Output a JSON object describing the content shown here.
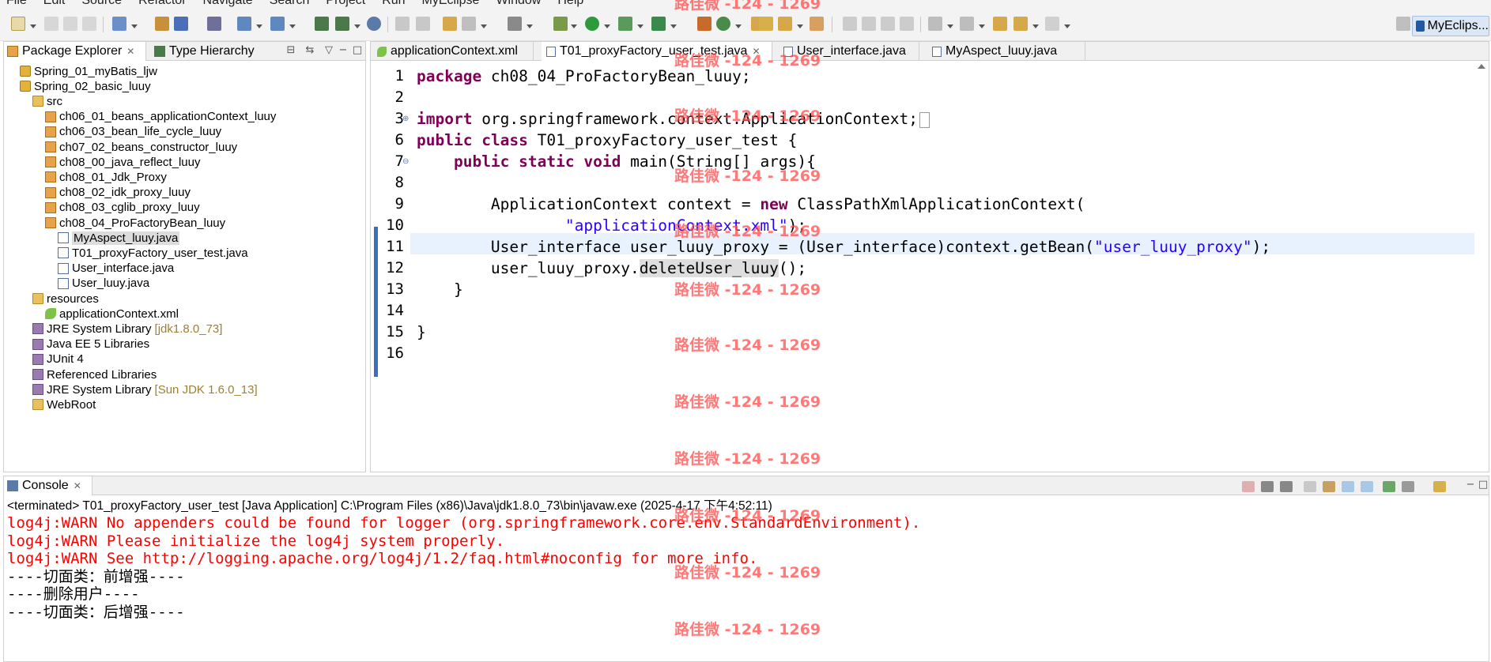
{
  "menubar": [
    "File",
    "Edit",
    "Source",
    "Refactor",
    "Navigate",
    "Search",
    "Project",
    "Run",
    "MyEclipse",
    "Window",
    "Help"
  ],
  "perspective": {
    "label": "MyEclips..."
  },
  "left_view": {
    "tabs": [
      {
        "label": "Package Explorer",
        "active": true
      },
      {
        "label": "Type Hierarchy",
        "active": false
      }
    ],
    "tree": [
      {
        "label": "Spring_01_myBatis_ljw",
        "icon": "project-icon",
        "depth": 0
      },
      {
        "label": "Spring_02_basic_luuy",
        "icon": "project-icon",
        "depth": 0
      },
      {
        "label": "src",
        "icon": "source-folder-icon",
        "depth": 1
      },
      {
        "label": "ch06_01_beans_applicationContext_luuy",
        "icon": "package-icon",
        "depth": 2
      },
      {
        "label": "ch06_03_bean_life_cycle_luuy",
        "icon": "package-icon",
        "depth": 2
      },
      {
        "label": "ch07_02_beans_constructor_luuy",
        "icon": "package-icon",
        "depth": 2
      },
      {
        "label": "ch08_00_java_reflect_luuy",
        "icon": "package-icon",
        "depth": 2
      },
      {
        "label": "ch08_01_Jdk_Proxy",
        "icon": "package-icon",
        "depth": 2
      },
      {
        "label": "ch08_02_idk_proxy_luuy",
        "icon": "package-icon",
        "depth": 2
      },
      {
        "label": "ch08_03_cglib_proxy_luuy",
        "icon": "package-icon",
        "depth": 2
      },
      {
        "label": "ch08_04_ProFactoryBean_luuy",
        "icon": "package-icon",
        "depth": 2
      },
      {
        "label": "MyAspect_luuy.java",
        "icon": "java-file-icon",
        "depth": 3,
        "selected": true
      },
      {
        "label": "T01_proxyFactory_user_test.java",
        "icon": "java-file-icon",
        "depth": 3
      },
      {
        "label": "User_interface.java",
        "icon": "java-file-icon",
        "depth": 3
      },
      {
        "label": "User_luuy.java",
        "icon": "java-file-icon",
        "depth": 3
      },
      {
        "label": "resources",
        "icon": "source-folder-icon",
        "depth": 1
      },
      {
        "label": "applicationContext.xml",
        "icon": "xml-file-icon",
        "depth": 2
      },
      {
        "label": "JRE System Library",
        "decoration": "[jdk1.8.0_73]",
        "icon": "library-icon",
        "depth": 1
      },
      {
        "label": "Java EE 5 Libraries",
        "icon": "library-icon",
        "depth": 1
      },
      {
        "label": "JUnit 4",
        "icon": "library-icon",
        "depth": 1
      },
      {
        "label": "Referenced Libraries",
        "icon": "library-icon",
        "depth": 1
      },
      {
        "label": "JRE System Library",
        "decoration": "[Sun JDK 1.6.0_13]",
        "icon": "library-icon",
        "depth": 1
      },
      {
        "label": "WebRoot",
        "icon": "folder-icon",
        "depth": 1
      }
    ]
  },
  "editor": {
    "tabs": [
      {
        "label": "applicationContext.xml",
        "icon": "xml-file-icon",
        "active": false
      },
      {
        "label": "T01_proxyFactory_user_test.java",
        "icon": "java-file-icon",
        "active": true,
        "closable": true
      },
      {
        "label": "User_interface.java",
        "icon": "java-file-icon",
        "active": false
      },
      {
        "label": "MyAspect_luuy.java",
        "icon": "java-file-icon",
        "active": false
      }
    ],
    "line_numbers": [
      "1",
      "2",
      "3",
      "6",
      "7",
      "8",
      "9",
      "10",
      "11",
      "12",
      "13",
      "14",
      "15",
      "16"
    ],
    "current_line": "8",
    "code": [
      [
        {
          "t": "package",
          "c": "kw"
        },
        {
          "t": " ch08_04_ProFactoryBean_luuy;"
        }
      ],
      [],
      [
        {
          "t": "import",
          "c": "kw"
        },
        {
          "t": " org.springframework.context.ApplicationContext;"
        }
      ],
      [
        {
          "t": "public",
          "c": "kw"
        },
        {
          "t": " "
        },
        {
          "t": "class",
          "c": "kw"
        },
        {
          "t": " T01_proxyFactory_user_test {"
        }
      ],
      [
        {
          "t": "    "
        },
        {
          "t": "public",
          "c": "kw"
        },
        {
          "t": " "
        },
        {
          "t": "static",
          "c": "kw"
        },
        {
          "t": " "
        },
        {
          "t": "void",
          "c": "kw"
        },
        {
          "t": " main(String[] args){"
        }
      ],
      [],
      [
        {
          "t": "        ApplicationContext context = "
        },
        {
          "t": "new",
          "c": "kw"
        },
        {
          "t": " ClassPathXmlApplicationContext("
        }
      ],
      [
        {
          "t": "                "
        },
        {
          "t": "\"applicationContext.xml\"",
          "c": "str"
        },
        {
          "t": ");"
        }
      ],
      [
        {
          "t": "        User_interface user_luuy_proxy = (User_interface)context.getBean("
        },
        {
          "t": "\"user_luuy_proxy\"",
          "c": "str"
        },
        {
          "t": ");"
        }
      ],
      [
        {
          "t": "        user_luuy_proxy."
        },
        {
          "t": "deleteUser_luuy",
          "c": "hl"
        },
        {
          "t": "();"
        }
      ],
      [
        {
          "t": "    }"
        }
      ],
      [],
      [
        {
          "t": "}"
        }
      ],
      []
    ]
  },
  "console": {
    "tab_label": "Console",
    "header": "<terminated> T01_proxyFactory_user_test [Java Application] C:\\Program Files (x86)\\Java\\jdk1.8.0_73\\bin\\javaw.exe (2025-4-17 下午4:52:11)",
    "lines": [
      {
        "text": "log4j:WARN No appenders could be found for logger (org.springframework.core.env.StandardEnvironment).",
        "type": "warn"
      },
      {
        "text": "log4j:WARN Please initialize the log4j system properly.",
        "type": "warn"
      },
      {
        "text": "log4j:WARN See http://logging.apache.org/log4j/1.2/faq.html#noconfig for more info.",
        "type": "warn"
      },
      {
        "text": "----切面类：前增强----",
        "type": "out"
      },
      {
        "text": "----删除用户----",
        "type": "out"
      },
      {
        "text": "----切面类：后增强----",
        "type": "out"
      }
    ]
  },
  "watermark": "路佳微 -124 - 1269",
  "colors": {
    "keyword": "#7f0055",
    "string": "#2a00ff",
    "warn": "#ff0000",
    "watermark": "#ff4d4d",
    "current_line": "#e8f2fe"
  }
}
